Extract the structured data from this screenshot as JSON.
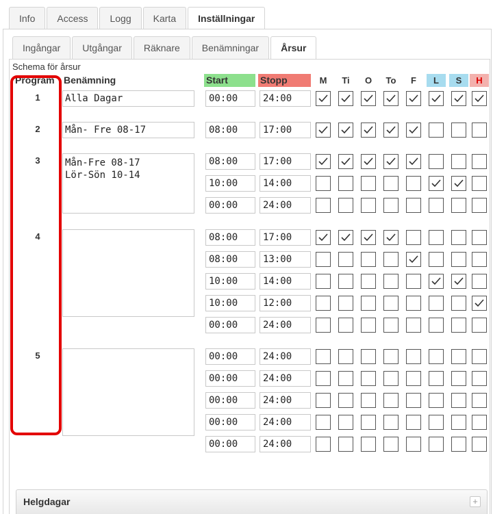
{
  "top_tabs": [
    "Info",
    "Access",
    "Logg",
    "Karta",
    "Inställningar"
  ],
  "top_active": "Inställningar",
  "sub_tabs": [
    "Ingångar",
    "Utgångar",
    "Räknare",
    "Benämningar",
    "Årsur"
  ],
  "sub_active": "Årsur",
  "section_title": "Schema för årsur",
  "headers": {
    "program": "Program",
    "name": "Benämning",
    "start": "Start",
    "stopp": "Stopp",
    "days": [
      "M",
      "Ti",
      "O",
      "To",
      "F",
      "L",
      "S",
      "H"
    ]
  },
  "colors": {
    "start_header": "#8de08d",
    "stopp_header": "#f07b73",
    "weekend_header": "#a7dcef",
    "holiday_header": "#f3b1ad",
    "highlight": "#e30000"
  },
  "programs": [
    {
      "number": "1",
      "name": "Alla Dagar",
      "rows": [
        {
          "start": "00:00",
          "stop": "24:00",
          "days": [
            true,
            true,
            true,
            true,
            true,
            true,
            true,
            true
          ]
        }
      ]
    },
    {
      "number": "2",
      "name": "Mån- Fre 08-17",
      "rows": [
        {
          "start": "08:00",
          "stop": "17:00",
          "days": [
            true,
            true,
            true,
            true,
            true,
            false,
            false,
            false
          ]
        }
      ]
    },
    {
      "number": "3",
      "name": "Mån-Fre 08-17\nLör-Sön 10-14",
      "rows": [
        {
          "start": "08:00",
          "stop": "17:00",
          "days": [
            true,
            true,
            true,
            true,
            true,
            false,
            false,
            false
          ]
        },
        {
          "start": "10:00",
          "stop": "14:00",
          "days": [
            false,
            false,
            false,
            false,
            false,
            true,
            true,
            false
          ]
        },
        {
          "start": "00:00",
          "stop": "24:00",
          "days": [
            false,
            false,
            false,
            false,
            false,
            false,
            false,
            false
          ]
        }
      ]
    },
    {
      "number": "4",
      "name": "",
      "rows": [
        {
          "start": "08:00",
          "stop": "17:00",
          "days": [
            true,
            true,
            true,
            true,
            false,
            false,
            false,
            false
          ]
        },
        {
          "start": "08:00",
          "stop": "13:00",
          "days": [
            false,
            false,
            false,
            false,
            true,
            false,
            false,
            false
          ]
        },
        {
          "start": "10:00",
          "stop": "14:00",
          "days": [
            false,
            false,
            false,
            false,
            false,
            true,
            true,
            false
          ]
        },
        {
          "start": "10:00",
          "stop": "12:00",
          "days": [
            false,
            false,
            false,
            false,
            false,
            false,
            false,
            true
          ]
        },
        {
          "start": "00:00",
          "stop": "24:00",
          "days": [
            false,
            false,
            false,
            false,
            false,
            false,
            false,
            false
          ]
        }
      ]
    },
    {
      "number": "5",
      "name": "",
      "rows": [
        {
          "start": "00:00",
          "stop": "24:00",
          "days": [
            false,
            false,
            false,
            false,
            false,
            false,
            false,
            false
          ]
        },
        {
          "start": "00:00",
          "stop": "24:00",
          "days": [
            false,
            false,
            false,
            false,
            false,
            false,
            false,
            false
          ]
        },
        {
          "start": "00:00",
          "stop": "24:00",
          "days": [
            false,
            false,
            false,
            false,
            false,
            false,
            false,
            false
          ]
        },
        {
          "start": "00:00",
          "stop": "24:00",
          "days": [
            false,
            false,
            false,
            false,
            false,
            false,
            false,
            false
          ]
        },
        {
          "start": "00:00",
          "stop": "24:00",
          "days": [
            false,
            false,
            false,
            false,
            false,
            false,
            false,
            false
          ]
        }
      ]
    }
  ],
  "holidays": {
    "label": "Helgdagar",
    "expand_icon": "plus-icon",
    "expand_symbol": "+"
  }
}
